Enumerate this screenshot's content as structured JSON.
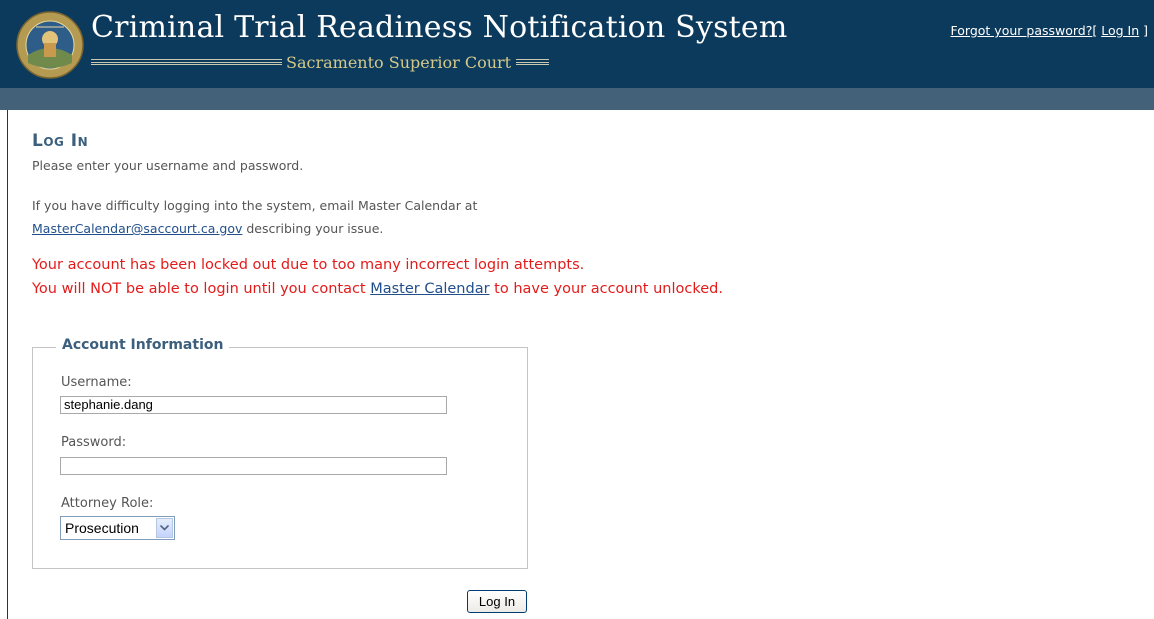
{
  "header": {
    "title": "Criminal Trial Readiness Notification System",
    "subtitle": "Sacramento Superior Court",
    "forgot_password_link": "Forgot your password?",
    "bracket_open": "[ ",
    "login_link": "Log In",
    "bracket_close": " ]"
  },
  "main": {
    "heading": "Log In",
    "instructions": "Please enter your username and password.",
    "difficulty_text": "If you have difficulty logging into the system, email Master Calendar at",
    "email_link": "MasterCalendar@saccourt.ca.gov",
    "difficulty_suffix": " describing your issue.",
    "error_line1": "Your account has been locked out due to too many incorrect login attempts.",
    "error_line2_prefix": "You will NOT be able to login until you contact ",
    "error_line2_link": "Master Calendar",
    "error_line2_suffix": " to have your account unlocked."
  },
  "form": {
    "legend": "Account Information",
    "username_label": "Username:",
    "username_value": "stephanie.dang",
    "password_label": "Password:",
    "password_value": "",
    "role_label": "Attorney Role:",
    "role_selected": "Prosecution",
    "submit_label": "Log In"
  },
  "colors": {
    "header_bg": "#0c3a5c",
    "subbar_bg": "#44617a",
    "heading": "#3b5f7c",
    "error": "#e31b1b",
    "link": "#214f8b",
    "subtitle": "#d4c98a"
  },
  "icons": {
    "seal": "court-seal-icon",
    "dropdown": "chevron-down-icon"
  }
}
